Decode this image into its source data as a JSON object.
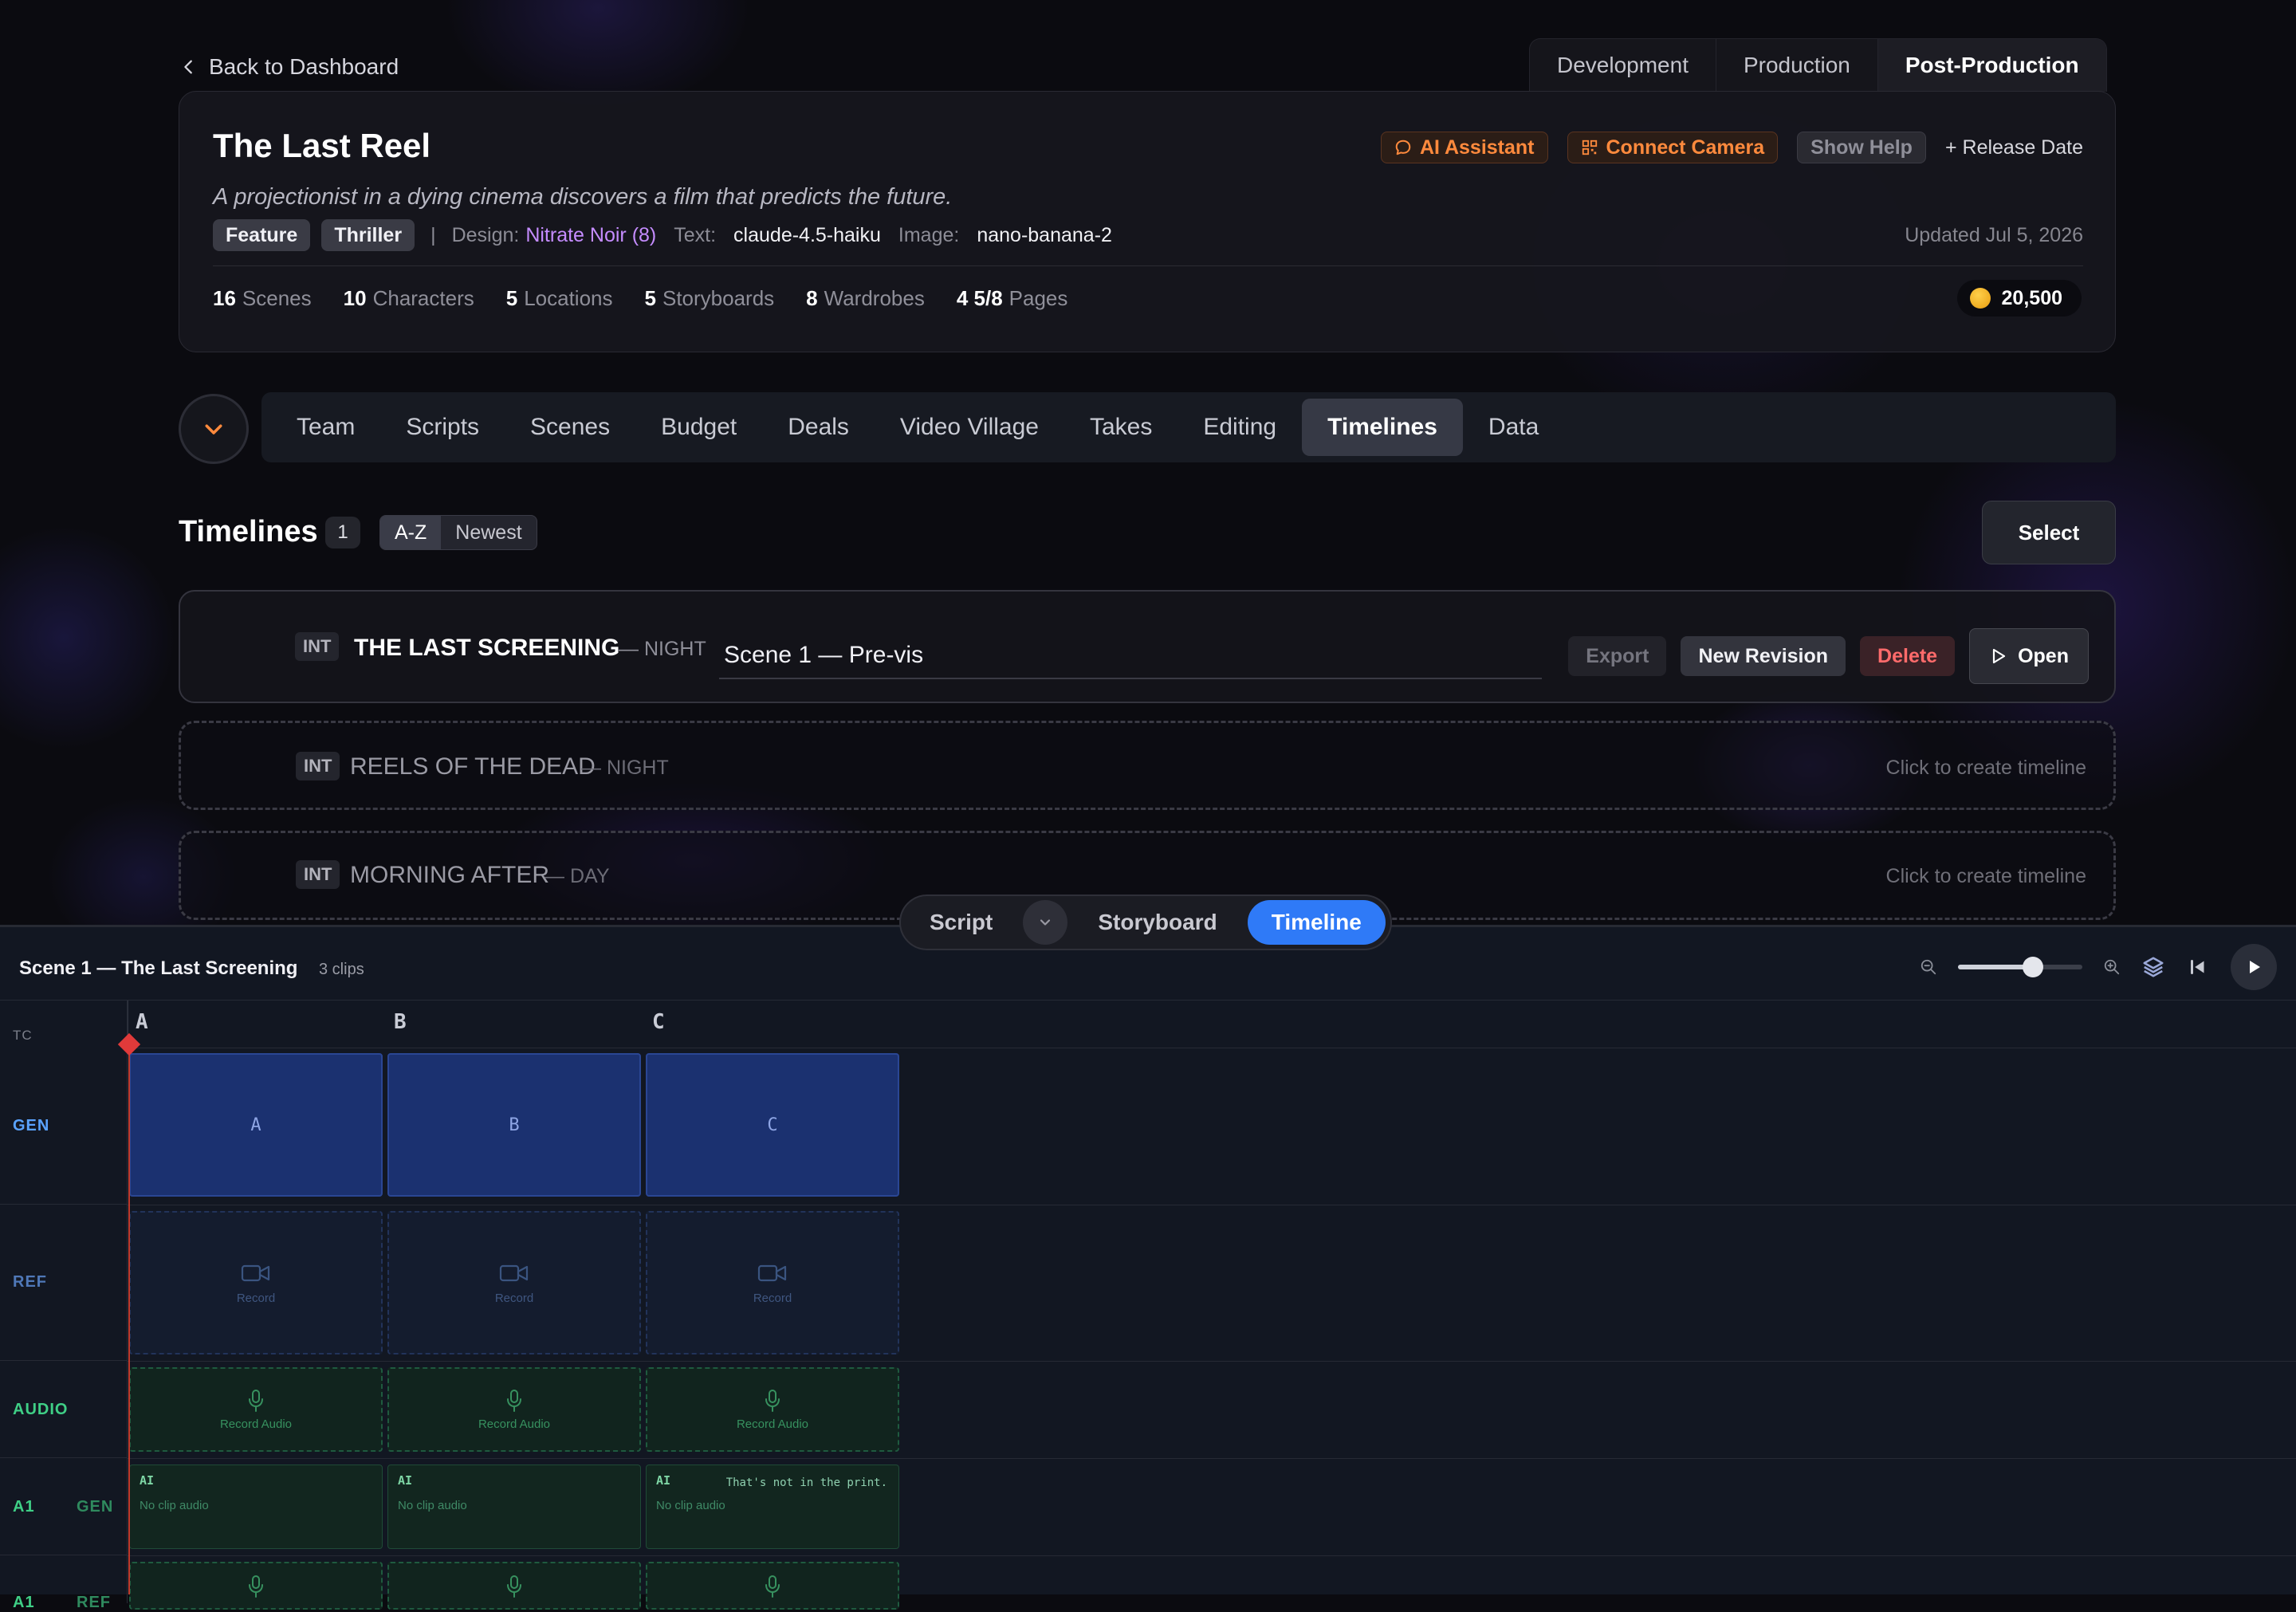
{
  "nav": {
    "back_label": "Back to Dashboard",
    "phase_tabs": [
      "Development",
      "Production",
      "Post-Production"
    ],
    "active_phase": "Post-Production"
  },
  "project": {
    "title": "The Last Reel",
    "logline": "A projectionist in a dying cinema discovers a film that predicts the future.",
    "tags": [
      "Feature",
      "Thriller"
    ],
    "design_label": "Design:",
    "design_value": "Nitrate Noir (8)",
    "text_label": "Text:",
    "text_value": "claude-4.5-haiku",
    "image_label": "Image:",
    "image_value": "nano-banana-2",
    "updated": "Updated Jul 5, 2026",
    "actions": {
      "ai_assistant": "AI Assistant",
      "connect_camera": "Connect Camera",
      "show_help": "Show Help",
      "release_date": "+ Release Date"
    },
    "stats": [
      {
        "value": "16",
        "label": "Scenes"
      },
      {
        "value": "10",
        "label": "Characters"
      },
      {
        "value": "5",
        "label": "Locations"
      },
      {
        "value": "5",
        "label": "Storyboards"
      },
      {
        "value": "8",
        "label": "Wardrobes"
      },
      {
        "value": "4 5/8",
        "label": "Pages"
      }
    ],
    "credits": "20,500",
    "accent_color": "#ff8a3d",
    "design_color": "#c58cff"
  },
  "subnav": {
    "items": [
      "Team",
      "Scripts",
      "Scenes",
      "Budget",
      "Deals",
      "Video Village",
      "Takes",
      "Editing",
      "Timelines",
      "Data"
    ],
    "active": "Timelines"
  },
  "timelines": {
    "title": "Timelines",
    "count": "1",
    "sort_options": [
      "A-Z",
      "Newest"
    ],
    "active_sort": "A-Z",
    "select_label": "Select",
    "rows": [
      {
        "int_ext": "INT",
        "scene": "THE LAST SCREENING",
        "time_of_day": "— NIGHT",
        "revision_name": "Scene 1 — Pre-vis",
        "buttons": {
          "export": "Export",
          "new_revision": "New Revision",
          "delete": "Delete",
          "open": "Open"
        }
      },
      {
        "int_ext": "INT",
        "scene": "REELS OF THE DEAD",
        "time_of_day": "— NIGHT",
        "hint": "Click to create timeline"
      },
      {
        "int_ext": "INT",
        "scene": "MORNING AFTER",
        "time_of_day": "— DAY",
        "hint": "Click to create timeline"
      }
    ]
  },
  "mode_switch": {
    "options": [
      "Script",
      "Storyboard",
      "Timeline"
    ],
    "active": "Timeline",
    "active_color": "#2f7af7"
  },
  "editor": {
    "title": "Scene 1 — The Last Screening",
    "clip_count": "3 clips",
    "zoom_level": 0.6,
    "tc_label": "TC",
    "ruler_marks": [
      "A",
      "B",
      "C"
    ],
    "tracks": {
      "gen": "GEN",
      "ref": "REF",
      "audio": "AUDIO",
      "a1": "A1",
      "a1_gen": "GEN",
      "a1b": "A1",
      "a1_ref": "REF"
    },
    "gen_clips": [
      "A",
      "B",
      "C"
    ],
    "ref_clip_label": "Record",
    "audio_clip_label": "Record Audio",
    "ai_tag": "AI",
    "ai_note": "No clip audio",
    "ai_quote": "That's not in the print.",
    "playhead_color": "#e03a3a"
  }
}
